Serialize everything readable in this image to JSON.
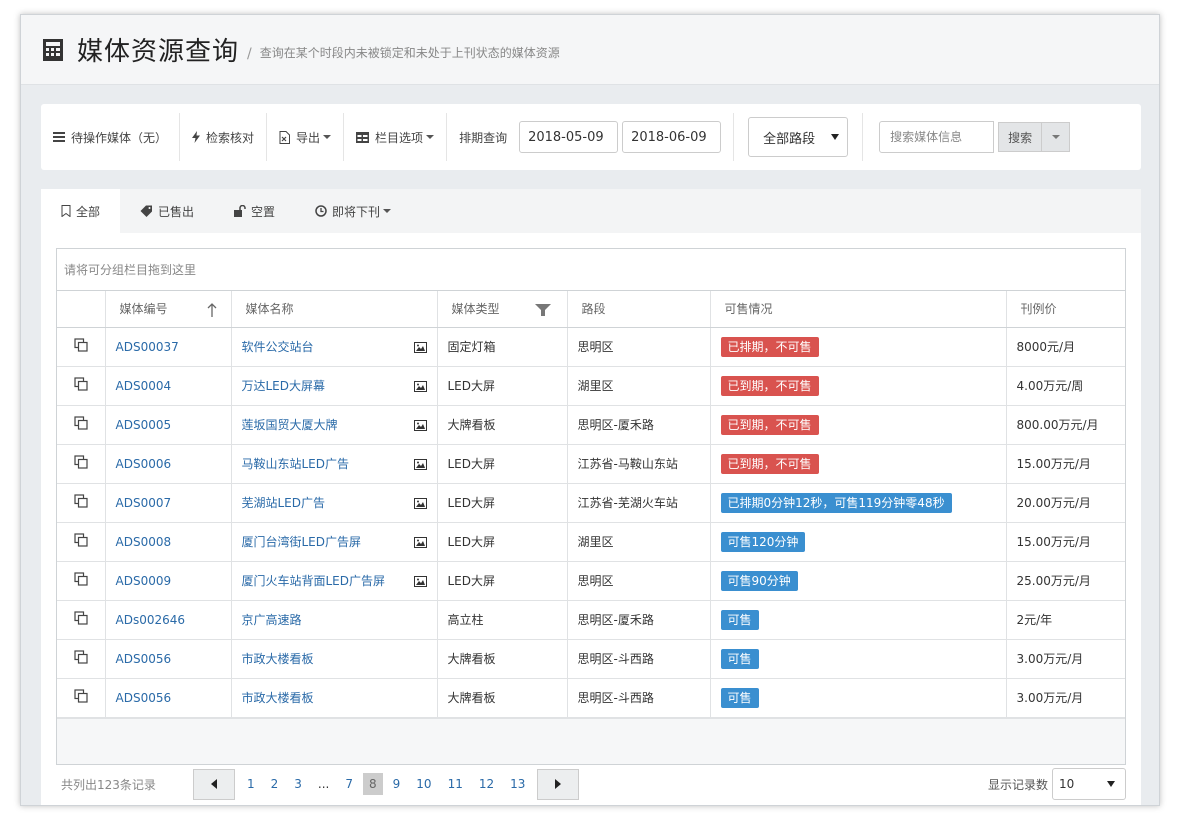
{
  "header": {
    "title": "媒体资源查询",
    "separator": "/",
    "subtitle": "查询在某个时段内未被锁定和未处于上刊状态的媒体资源"
  },
  "toolbar": {
    "pending": "待操作媒体（无）",
    "check": "检索核对",
    "export": "导出",
    "columns": "栏目选项",
    "schedule_label": "排期查询",
    "date_from": "2018-05-09",
    "date_to": "2018-06-09",
    "route_select": "全部路段",
    "search_placeholder": "搜索媒体信息",
    "search_button": "搜索"
  },
  "tabs": [
    {
      "label": "全部",
      "icon": "bookmark-icon"
    },
    {
      "label": "已售出",
      "icon": "tag-icon"
    },
    {
      "label": "空置",
      "icon": "unlock-icon"
    },
    {
      "label": "即将下刊",
      "icon": "clock-icon"
    }
  ],
  "grid": {
    "group_hint": "请将可分组栏目拖到这里",
    "columns": [
      "媒体编号",
      "媒体名称",
      "媒体类型",
      "路段",
      "可售情况",
      "刊例价"
    ],
    "rows": [
      {
        "id": "ADS00037",
        "name": "软件公交站台",
        "has_image": true,
        "type": "固定灯箱",
        "road": "思明区",
        "status": "已排期，不可售",
        "status_kind": "red",
        "price": "8000元/月"
      },
      {
        "id": "ADS0004",
        "name": "万达LED大屏幕",
        "has_image": true,
        "type": "LED大屏",
        "road": "湖里区",
        "status": "已到期，不可售",
        "status_kind": "red",
        "price": "4.00万元/周"
      },
      {
        "id": "ADS0005",
        "name": "莲坂国贸大厦大牌",
        "has_image": true,
        "type": "大牌看板",
        "road": "思明区-厦禾路",
        "status": "已到期，不可售",
        "status_kind": "red",
        "price": "800.00万元/月"
      },
      {
        "id": "ADS0006",
        "name": "马鞍山东站LED广告",
        "has_image": true,
        "type": "LED大屏",
        "road": "江苏省-马鞍山东站",
        "status": "已到期，不可售",
        "status_kind": "red",
        "price": "15.00万元/月"
      },
      {
        "id": "ADS0007",
        "name": "芜湖站LED广告",
        "has_image": true,
        "type": "LED大屏",
        "road": "江苏省-芜湖火车站",
        "status": "已排期0分钟12秒，可售119分钟零48秒",
        "status_kind": "blue",
        "price": "20.00万元/月"
      },
      {
        "id": "ADS0008",
        "name": "厦门台湾街LED广告屏",
        "has_image": true,
        "type": "LED大屏",
        "road": "湖里区",
        "status": "可售120分钟",
        "status_kind": "blue",
        "price": "15.00万元/月"
      },
      {
        "id": "ADS0009",
        "name": "厦门火车站背面LED广告屏",
        "has_image": true,
        "type": "LED大屏",
        "road": "思明区",
        "status": "可售90分钟",
        "status_kind": "blue",
        "price": "25.00万元/月"
      },
      {
        "id": "ADs002646",
        "name": "京广高速路",
        "has_image": false,
        "type": "高立柱",
        "road": "思明区-厦禾路",
        "status": "可售",
        "status_kind": "blue",
        "price": "2元/年"
      },
      {
        "id": "ADS0056",
        "name": "市政大楼看板",
        "has_image": false,
        "type": "大牌看板",
        "road": "思明区-斗西路",
        "status": "可售",
        "status_kind": "blue",
        "price": "3.00万元/月"
      },
      {
        "id": "ADS0056",
        "name": "市政大楼看板",
        "has_image": false,
        "type": "大牌看板",
        "road": "思明区-斗西路",
        "status": "可售",
        "status_kind": "blue",
        "price": "3.00万元/月"
      }
    ]
  },
  "pager": {
    "total": "共列出123条记录",
    "pages": [
      "1",
      "2",
      "3",
      "...",
      "7",
      "8",
      "9",
      "10",
      "11",
      "12",
      "13"
    ],
    "current": "8",
    "per_page_label": "显示记录数",
    "per_page": "10"
  },
  "colors": {
    "red": "#d9534f",
    "blue": "#3a8fd0",
    "link": "#2a6aa8"
  }
}
